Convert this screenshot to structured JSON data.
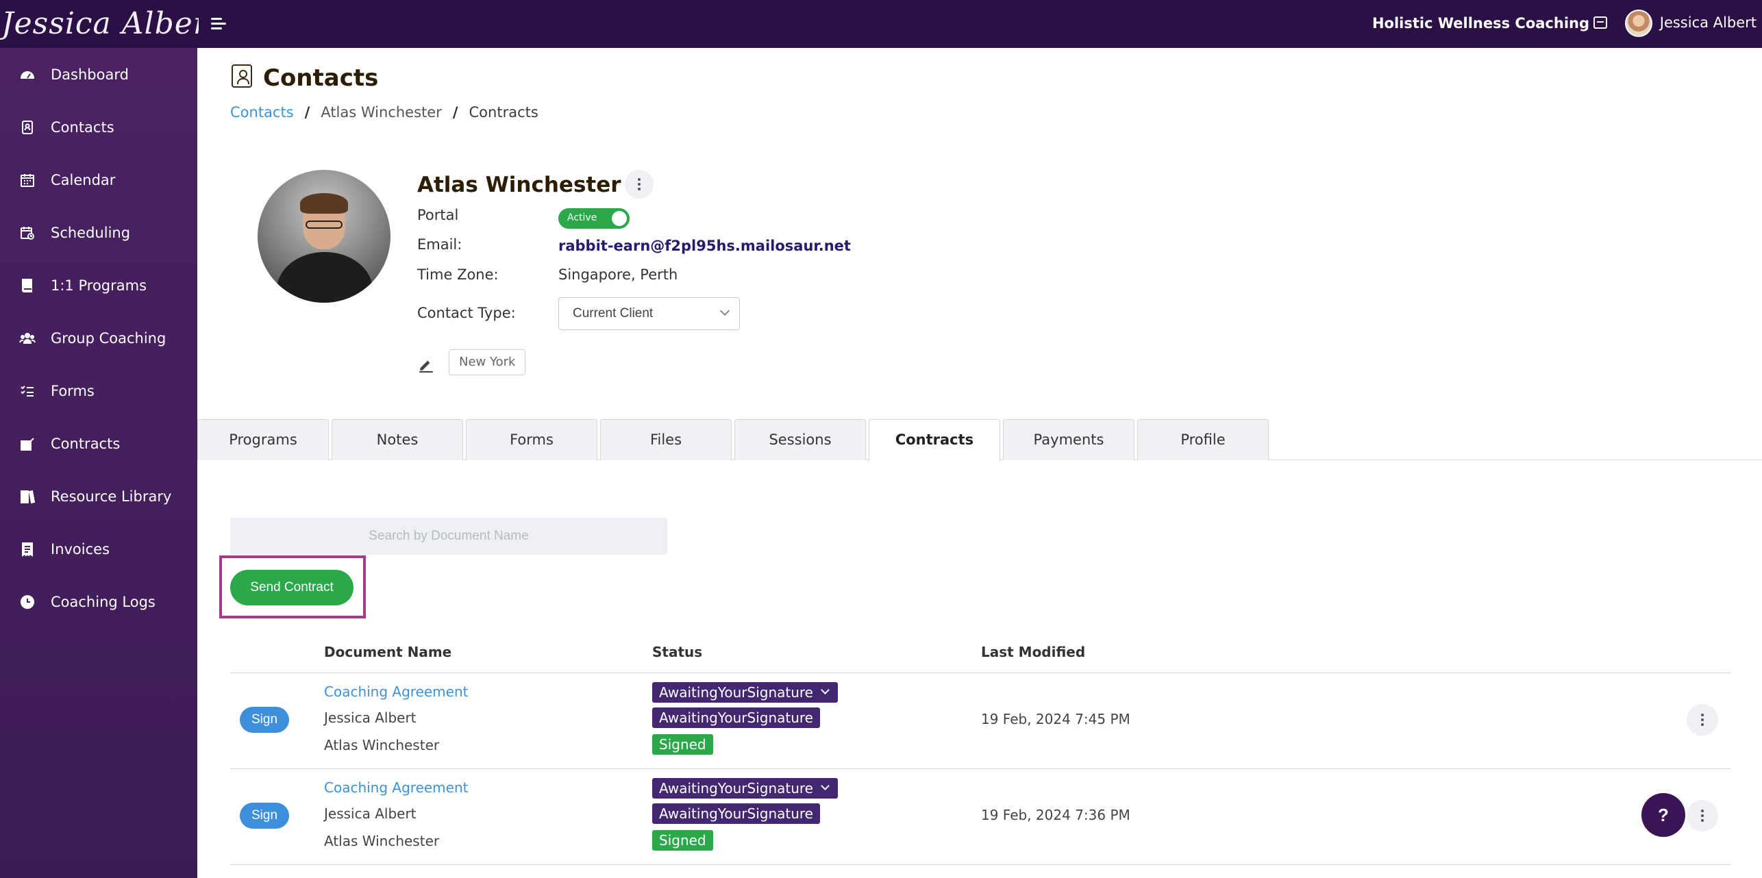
{
  "header": {
    "brand": "Jessica Albert",
    "org_name": "Holistic Wellness Coaching",
    "user_name": "Jessica Albert"
  },
  "sidebar": {
    "items": [
      {
        "label": "Dashboard",
        "icon": "dashboard-icon"
      },
      {
        "label": "Contacts",
        "icon": "contacts-icon"
      },
      {
        "label": "Calendar",
        "icon": "calendar-icon"
      },
      {
        "label": "Scheduling",
        "icon": "scheduling-icon"
      },
      {
        "label": "1:1 Programs",
        "icon": "book-icon"
      },
      {
        "label": "Group Coaching",
        "icon": "group-icon"
      },
      {
        "label": "Forms",
        "icon": "checklist-icon"
      },
      {
        "label": "Contracts",
        "icon": "contract-icon"
      },
      {
        "label": "Resource Library",
        "icon": "library-icon"
      },
      {
        "label": "Invoices",
        "icon": "invoice-icon"
      },
      {
        "label": "Coaching Logs",
        "icon": "clock-icon"
      }
    ]
  },
  "page": {
    "title": "Contacts",
    "breadcrumb": [
      "Contacts",
      "Atlas Winchester",
      "Contracts"
    ]
  },
  "contact": {
    "name": "Atlas Winchester",
    "portal_label": "Portal",
    "portal_status": "Active",
    "email_label": "Email:",
    "email": "rabbit-earn@f2pl95hs.mailosaur.net",
    "timezone_label": "Time Zone:",
    "timezone": "Singapore, Perth",
    "contact_type_label": "Contact Type:",
    "contact_type": "Current Client",
    "tag": "New York"
  },
  "tabs": [
    "Programs",
    "Notes",
    "Forms",
    "Files",
    "Sessions",
    "Contracts",
    "Payments",
    "Profile"
  ],
  "active_tab": "Contracts",
  "search": {
    "placeholder": "Search by Document Name"
  },
  "send_contract_label": "Send Contract",
  "table": {
    "headers": [
      "Document Name",
      "Status",
      "Last Modified"
    ],
    "rows": [
      {
        "action": "Sign",
        "document": "Coaching Agreement",
        "party1": "Jessica Albert",
        "party2": "Atlas Winchester",
        "status_main": "AwaitingYourSignature",
        "status_party1": "AwaitingYourSignature",
        "status_party2": "Signed",
        "last_modified": "19 Feb, 2024 7:45 PM"
      },
      {
        "action": "Sign",
        "document": "Coaching Agreement",
        "party1": "Jessica Albert",
        "party2": "Atlas Winchester",
        "status_main": "AwaitingYourSignature",
        "status_party1": "AwaitingYourSignature",
        "status_party2": "Signed",
        "last_modified": "19 Feb, 2024 7:36 PM"
      }
    ]
  },
  "help_label": "?",
  "colors": {
    "topbar": "#2a1045",
    "sidebar": "#4a2262",
    "accent_green": "#2aa84a",
    "link_blue": "#3d92d6",
    "badge_purple": "#432770",
    "highlight": "#a83a8c"
  }
}
